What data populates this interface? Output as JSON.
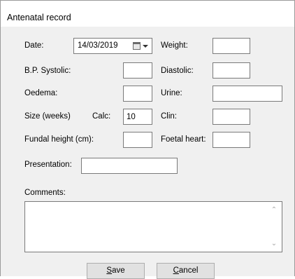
{
  "window": {
    "title": "Antenatal record"
  },
  "labels": {
    "date": "Date:",
    "weight": "Weight:",
    "bp_systolic": "B.P.  Systolic:",
    "diastolic": "Diastolic:",
    "oedema": "Oedema:",
    "urine": "Urine:",
    "size_weeks": "Size (weeks)",
    "calc": "Calc:",
    "clin": "Clin:",
    "fundal_height": "Fundal height (cm):",
    "foetal_heart": "Foetal heart:",
    "presentation": "Presentation:",
    "comments": "Comments:"
  },
  "values": {
    "date": "14/03/2019",
    "weight": "",
    "systolic": "",
    "diastolic": "",
    "oedema": "",
    "urine": "",
    "calc": "10",
    "clin": "",
    "fundal_height": "",
    "foetal_heart": "",
    "presentation": "",
    "comments": ""
  },
  "buttons": {
    "save_accel": "S",
    "save_rest": "ave",
    "cancel_accel": "C",
    "cancel_rest": "ancel"
  },
  "icons": {
    "calendar": "calendar-icon",
    "dropdown": "chevron-down-icon",
    "scroll_up": "chevron-up-icon",
    "scroll_down": "chevron-down-icon"
  }
}
